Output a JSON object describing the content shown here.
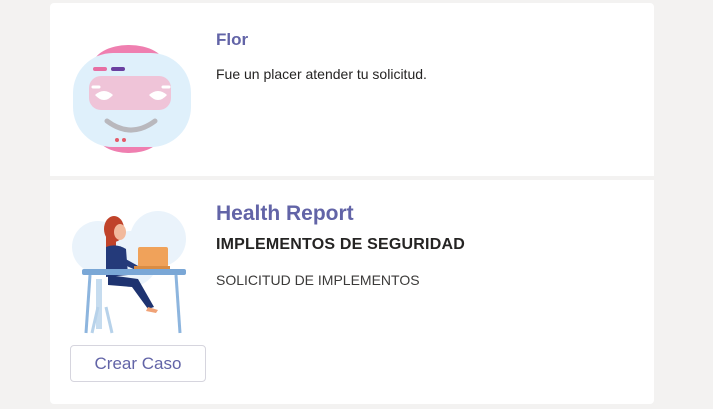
{
  "bot_card": {
    "name": "Flor",
    "message": "Fue un placer atender tu solicitud."
  },
  "report_card": {
    "title": "Health Report",
    "subtitle": "IMPLEMENTOS DE SEGURIDAD",
    "description": "SOLICITUD DE IMPLEMENTOS",
    "button_label": "Crear Caso"
  },
  "icons": {
    "bot": "robot-avatar-icon",
    "illustration": "woman-at-laptop-illustration"
  },
  "colors": {
    "accent": "#6264a7",
    "background": "#f3f2f1",
    "card": "#ffffff"
  }
}
